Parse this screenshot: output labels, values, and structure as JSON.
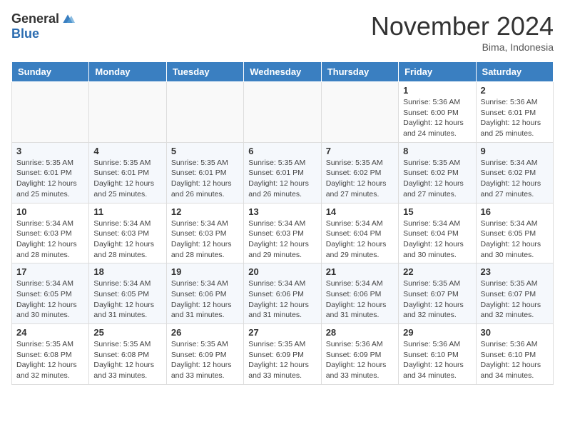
{
  "header": {
    "logo_general": "General",
    "logo_blue": "Blue",
    "month_title": "November 2024",
    "location": "Bima, Indonesia"
  },
  "weekdays": [
    "Sunday",
    "Monday",
    "Tuesday",
    "Wednesday",
    "Thursday",
    "Friday",
    "Saturday"
  ],
  "weeks": [
    [
      {
        "day": "",
        "info": ""
      },
      {
        "day": "",
        "info": ""
      },
      {
        "day": "",
        "info": ""
      },
      {
        "day": "",
        "info": ""
      },
      {
        "day": "",
        "info": ""
      },
      {
        "day": "1",
        "info": "Sunrise: 5:36 AM\nSunset: 6:00 PM\nDaylight: 12 hours and 24 minutes."
      },
      {
        "day": "2",
        "info": "Sunrise: 5:36 AM\nSunset: 6:01 PM\nDaylight: 12 hours and 25 minutes."
      }
    ],
    [
      {
        "day": "3",
        "info": "Sunrise: 5:35 AM\nSunset: 6:01 PM\nDaylight: 12 hours and 25 minutes."
      },
      {
        "day": "4",
        "info": "Sunrise: 5:35 AM\nSunset: 6:01 PM\nDaylight: 12 hours and 25 minutes."
      },
      {
        "day": "5",
        "info": "Sunrise: 5:35 AM\nSunset: 6:01 PM\nDaylight: 12 hours and 26 minutes."
      },
      {
        "day": "6",
        "info": "Sunrise: 5:35 AM\nSunset: 6:01 PM\nDaylight: 12 hours and 26 minutes."
      },
      {
        "day": "7",
        "info": "Sunrise: 5:35 AM\nSunset: 6:02 PM\nDaylight: 12 hours and 27 minutes."
      },
      {
        "day": "8",
        "info": "Sunrise: 5:35 AM\nSunset: 6:02 PM\nDaylight: 12 hours and 27 minutes."
      },
      {
        "day": "9",
        "info": "Sunrise: 5:34 AM\nSunset: 6:02 PM\nDaylight: 12 hours and 27 minutes."
      }
    ],
    [
      {
        "day": "10",
        "info": "Sunrise: 5:34 AM\nSunset: 6:03 PM\nDaylight: 12 hours and 28 minutes."
      },
      {
        "day": "11",
        "info": "Sunrise: 5:34 AM\nSunset: 6:03 PM\nDaylight: 12 hours and 28 minutes."
      },
      {
        "day": "12",
        "info": "Sunrise: 5:34 AM\nSunset: 6:03 PM\nDaylight: 12 hours and 28 minutes."
      },
      {
        "day": "13",
        "info": "Sunrise: 5:34 AM\nSunset: 6:03 PM\nDaylight: 12 hours and 29 minutes."
      },
      {
        "day": "14",
        "info": "Sunrise: 5:34 AM\nSunset: 6:04 PM\nDaylight: 12 hours and 29 minutes."
      },
      {
        "day": "15",
        "info": "Sunrise: 5:34 AM\nSunset: 6:04 PM\nDaylight: 12 hours and 30 minutes."
      },
      {
        "day": "16",
        "info": "Sunrise: 5:34 AM\nSunset: 6:05 PM\nDaylight: 12 hours and 30 minutes."
      }
    ],
    [
      {
        "day": "17",
        "info": "Sunrise: 5:34 AM\nSunset: 6:05 PM\nDaylight: 12 hours and 30 minutes."
      },
      {
        "day": "18",
        "info": "Sunrise: 5:34 AM\nSunset: 6:05 PM\nDaylight: 12 hours and 31 minutes."
      },
      {
        "day": "19",
        "info": "Sunrise: 5:34 AM\nSunset: 6:06 PM\nDaylight: 12 hours and 31 minutes."
      },
      {
        "day": "20",
        "info": "Sunrise: 5:34 AM\nSunset: 6:06 PM\nDaylight: 12 hours and 31 minutes."
      },
      {
        "day": "21",
        "info": "Sunrise: 5:34 AM\nSunset: 6:06 PM\nDaylight: 12 hours and 31 minutes."
      },
      {
        "day": "22",
        "info": "Sunrise: 5:35 AM\nSunset: 6:07 PM\nDaylight: 12 hours and 32 minutes."
      },
      {
        "day": "23",
        "info": "Sunrise: 5:35 AM\nSunset: 6:07 PM\nDaylight: 12 hours and 32 minutes."
      }
    ],
    [
      {
        "day": "24",
        "info": "Sunrise: 5:35 AM\nSunset: 6:08 PM\nDaylight: 12 hours and 32 minutes."
      },
      {
        "day": "25",
        "info": "Sunrise: 5:35 AM\nSunset: 6:08 PM\nDaylight: 12 hours and 33 minutes."
      },
      {
        "day": "26",
        "info": "Sunrise: 5:35 AM\nSunset: 6:09 PM\nDaylight: 12 hours and 33 minutes."
      },
      {
        "day": "27",
        "info": "Sunrise: 5:35 AM\nSunset: 6:09 PM\nDaylight: 12 hours and 33 minutes."
      },
      {
        "day": "28",
        "info": "Sunrise: 5:36 AM\nSunset: 6:09 PM\nDaylight: 12 hours and 33 minutes."
      },
      {
        "day": "29",
        "info": "Sunrise: 5:36 AM\nSunset: 6:10 PM\nDaylight: 12 hours and 34 minutes."
      },
      {
        "day": "30",
        "info": "Sunrise: 5:36 AM\nSunset: 6:10 PM\nDaylight: 12 hours and 34 minutes."
      }
    ]
  ]
}
